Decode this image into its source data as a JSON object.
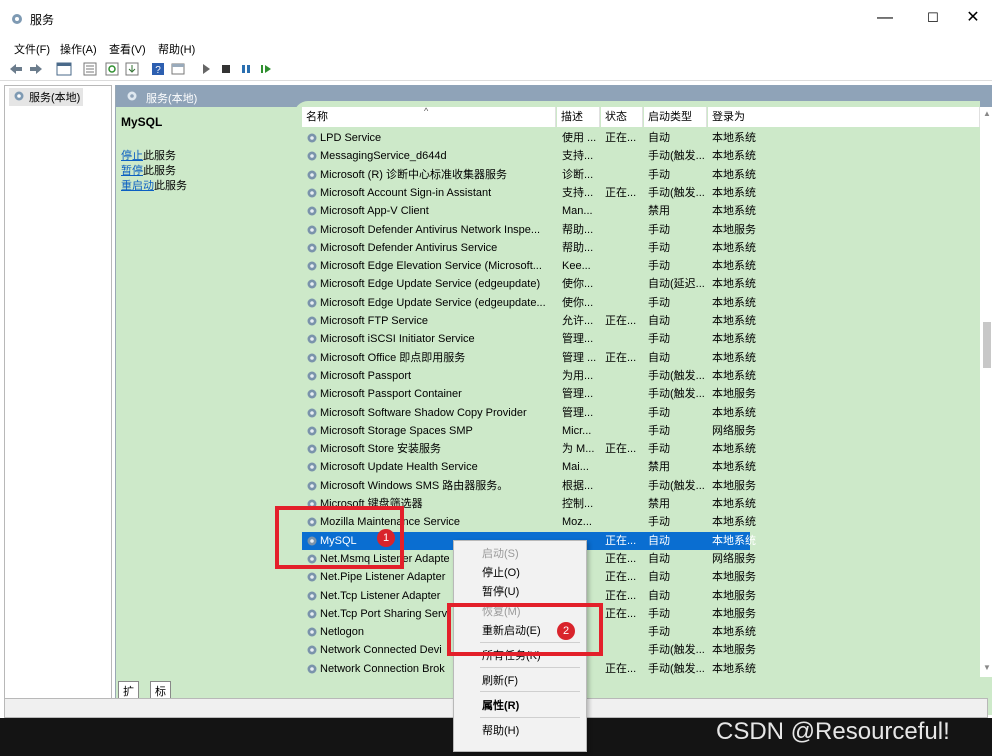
{
  "window": {
    "title": "服务",
    "controls": [
      "—",
      "☐",
      "✕"
    ]
  },
  "menu": [
    "文件(F)",
    "操作(A)",
    "查看(V)",
    "帮助(H)"
  ],
  "tree": {
    "root": "服务(本地)"
  },
  "pane": {
    "header": "服务(本地)",
    "selected_name": "MySQL",
    "actions": [
      {
        "link": "停止",
        "suffix": "此服务"
      },
      {
        "link": "暂停",
        "suffix": "此服务"
      },
      {
        "link": "重启动",
        "suffix": "此服务"
      }
    ]
  },
  "columns": [
    "名称",
    "描述",
    "状态",
    "启动类型",
    "登录为"
  ],
  "rows": [
    [
      "LPD Service",
      "使用 ...",
      "正在...",
      "自动",
      "本地系统"
    ],
    [
      "MessagingService_d644d",
      "支持...",
      "",
      "手动(触发...",
      "本地系统"
    ],
    [
      "Microsoft (R) 诊断中心标准收集器服务",
      "诊断...",
      "",
      "手动",
      "本地系统"
    ],
    [
      "Microsoft Account Sign-in Assistant",
      "支持...",
      "正在...",
      "手动(触发...",
      "本地系统"
    ],
    [
      "Microsoft App-V Client",
      "Man...",
      "",
      "禁用",
      "本地系统"
    ],
    [
      "Microsoft Defender Antivirus Network Inspe...",
      "帮助...",
      "",
      "手动",
      "本地服务"
    ],
    [
      "Microsoft Defender Antivirus Service",
      "帮助...",
      "",
      "手动",
      "本地系统"
    ],
    [
      "Microsoft Edge Elevation Service (Microsoft...",
      "Kee...",
      "",
      "手动",
      "本地系统"
    ],
    [
      "Microsoft Edge Update Service (edgeupdate)",
      "使你...",
      "",
      "自动(延迟...",
      "本地系统"
    ],
    [
      "Microsoft Edge Update Service (edgeupdate...",
      "使你...",
      "",
      "手动",
      "本地系统"
    ],
    [
      "Microsoft FTP Service",
      "允许...",
      "正在...",
      "自动",
      "本地系统"
    ],
    [
      "Microsoft iSCSI Initiator Service",
      "管理...",
      "",
      "手动",
      "本地系统"
    ],
    [
      "Microsoft Office 即点即用服务",
      "管理 ...",
      "正在...",
      "自动",
      "本地系统"
    ],
    [
      "Microsoft Passport",
      "为用...",
      "",
      "手动(触发...",
      "本地系统"
    ],
    [
      "Microsoft Passport Container",
      "管理...",
      "",
      "手动(触发...",
      "本地服务"
    ],
    [
      "Microsoft Software Shadow Copy Provider",
      "管理...",
      "",
      "手动",
      "本地系统"
    ],
    [
      "Microsoft Storage Spaces SMP",
      "Micr...",
      "",
      "手动",
      "网络服务"
    ],
    [
      "Microsoft Store 安装服务",
      "为 M...",
      "正在...",
      "手动",
      "本地系统"
    ],
    [
      "Microsoft Update Health Service",
      "Mai...",
      "",
      "禁用",
      "本地系统"
    ],
    [
      "Microsoft Windows SMS 路由器服务。",
      "根据...",
      "",
      "手动(触发...",
      "本地服务"
    ],
    [
      "Microsoft 键盘筛选器",
      "控制...",
      "",
      "禁用",
      "本地系统"
    ],
    [
      "Mozilla Maintenance Service",
      "Moz...",
      "",
      "手动",
      "本地系统"
    ],
    [
      "MySQL",
      "",
      "正在...",
      "自动",
      "本地系统"
    ],
    [
      "Net.Msmq Listener Adapte",
      "",
      "正在...",
      "自动",
      "网络服务"
    ],
    [
      "Net.Pipe Listener Adapter",
      "",
      "正在...",
      "自动",
      "本地服务"
    ],
    [
      "Net.Tcp Listener Adapter",
      "",
      "正在...",
      "自动",
      "本地服务"
    ],
    [
      "Net.Tcp Port Sharing Serv",
      "",
      "正在...",
      "手动",
      "本地服务"
    ],
    [
      "Netlogon",
      "",
      "",
      "手动",
      "本地系统"
    ],
    [
      "Network Connected Devi",
      "",
      "",
      "手动(触发...",
      "本地服务"
    ],
    [
      "Network Connection Brok",
      "",
      "正在...",
      "手动(触发...",
      "本地系统"
    ]
  ],
  "tabs": [
    "扩展",
    "标准"
  ],
  "context_menu": {
    "start": "启动(S)",
    "stop": "停止(O)",
    "pause": "暂停(U)",
    "resume": "恢复(M)",
    "restart": "重新启动(E)",
    "all_tasks": "所有任务(K)",
    "refresh": "刷新(F)",
    "properties": "属性(R)",
    "help": "帮助(H)"
  },
  "annotations": {
    "badge1": "1",
    "badge2": "2"
  },
  "watermark": "CSDN @Resourceful!",
  "colors": {
    "selection": "#0a6ed1",
    "pane_bg": "#cde9c9",
    "annotation_red": "#e3202a"
  }
}
